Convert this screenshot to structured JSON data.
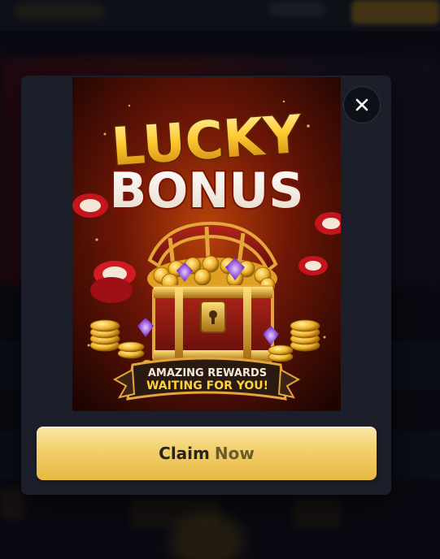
{
  "modal": {
    "promo_image": {
      "title_line1": "LUCKY",
      "title_line2": "BONUS",
      "ribbon_line1": "AMAZING REWARDS",
      "ribbon_line2": "WAITING FOR YOU!"
    },
    "claim_button": {
      "word1": "Claim",
      "word2": "Now"
    },
    "close_icon": "close-icon"
  },
  "colors": {
    "modal_bg": "#1c1f2a",
    "button_gold": "#f3cf6b",
    "title_gold": "#ffcc33",
    "ribbon_text": "#ffd23a"
  }
}
